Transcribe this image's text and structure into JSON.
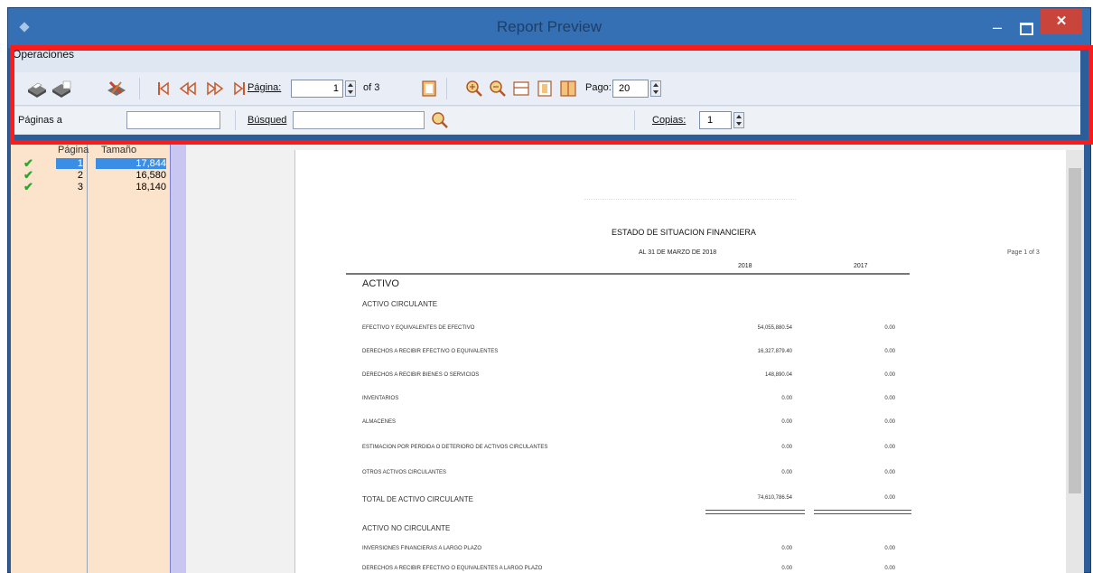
{
  "window": {
    "title": "Report Preview",
    "minimize_label": "–",
    "close_label": "✕"
  },
  "toolbar": {
    "group_label": "Operaciones",
    "pagina_label": "Página:",
    "pagina_value": "1",
    "of_label": "of 3",
    "pago_label": "Pago:",
    "pago_value": "20",
    "paginas_label": "Páginas a",
    "busqueda_label": "Búsqued",
    "copias_label": "Copias:",
    "copias_value": "1",
    "icons": [
      "print-icon",
      "print-setup-icon",
      "export-icon",
      "first-page-icon",
      "prev-page-icon",
      "next-page-icon",
      "last-page-icon",
      "single-page-icon",
      "zoom-in-icon",
      "zoom-out-icon",
      "page-width-icon",
      "page-height-icon",
      "two-pages-icon",
      "search-icon"
    ]
  },
  "pages_panel": {
    "headers": [
      "Página",
      "Tamaño"
    ],
    "rows": [
      {
        "page": "1",
        "size": "17,844",
        "selected": true
      },
      {
        "page": "2",
        "size": "16,580",
        "selected": false
      },
      {
        "page": "3",
        "size": "18,140",
        "selected": false
      }
    ]
  },
  "report": {
    "title": "ESTADO DE SITUACION FINANCIERA",
    "subtitle": "AL 31 DE MARZO DE 2018",
    "page_indicator": "Page 1 of 3",
    "year_current": "2018",
    "year_prior": "2017",
    "section": "ACTIVO",
    "subsection1": "ACTIVO CIRCULANTE",
    "lines": [
      {
        "label": "EFECTIVO Y EQUIVALENTES DE EFECTIVO",
        "v2018": "54,055,880.54",
        "v2017": "0.00"
      },
      {
        "label": "DERECHOS A RECIBIR EFECTIVO O EQUIVALENTES",
        "v2018": "16,327,879.40",
        "v2017": "0.00"
      },
      {
        "label": "DERECHOS A RECIBIR BIENES O SERVICIOS",
        "v2018": "148,890.04",
        "v2017": "0.00"
      },
      {
        "label": "INVENTARIOS",
        "v2018": "0.00",
        "v2017": "0.00"
      },
      {
        "label": "ALMACENES",
        "v2018": "0.00",
        "v2017": "0.00"
      },
      {
        "label": "ESTIMACION POR PERDIDA O DETERIORO DE ACTIVOS CIRCULANTES",
        "v2018": "0.00",
        "v2017": "0.00"
      },
      {
        "label": "OTROS ACTIVOS CIRCULANTES",
        "v2018": "0.00",
        "v2017": "0.00"
      }
    ],
    "total_label": "TOTAL DE ACTIVO CIRCULANTE",
    "total_2018": "74,610,786.54",
    "total_2017": "0.00",
    "subsection2": "ACTIVO NO CIRCULANTE",
    "line_nc1_label": "INVERSIONES FINANCIERAS A LARGO PLAZO",
    "line_nc1_2018": "0.00",
    "line_nc1_2017": "0.00",
    "line_nc2_label": "DERECHOS A RECIBIR EFECTIVO O EQUIVALENTES A LARGO PLAZO",
    "line_nc2_2018": "0.00",
    "line_nc2_2017": "0.00"
  },
  "colors": {
    "titlebar": "#3470b3",
    "highlight": "#ff1a1a",
    "panel": "#fbe3cc",
    "selected": "#3b8ee6"
  }
}
